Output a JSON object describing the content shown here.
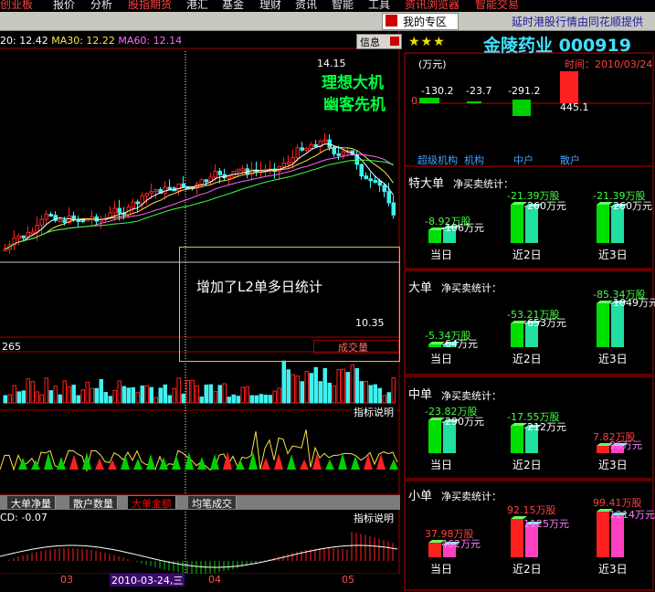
{
  "menu": {
    "items": [
      "创业板",
      "报价",
      "分析",
      "股指期货",
      "港汇",
      "基金",
      "理财",
      "资讯",
      "智能",
      "工具",
      "资讯浏览器",
      "智能交易"
    ]
  },
  "toolbar": {
    "my_zone": "我的专区",
    "provider": "延时港股行情由同花顺提供"
  },
  "chart": {
    "ma_prefix": "20: 12.42",
    "ma30": "MA30: 12.22",
    "ma60": "MA60: 12.14",
    "info_button": "信息",
    "high_price": "14.15",
    "low_price": "10.35",
    "watermark_line1": "理想大机",
    "watermark_line2": "幽客先机",
    "note": "增加了L2单多日统计",
    "volume_left": "265",
    "volume_label": "成交量",
    "indicator_explain": "指标说明",
    "macd": "CD: -0.07",
    "dates": [
      "03",
      "04",
      "05"
    ],
    "highlight_date": "2010-03-24,三"
  },
  "tabs": [
    "大单净量",
    "散户数量",
    "大单金额",
    "均笔成交"
  ],
  "tabs_active": 2,
  "right": {
    "stars": "★★★",
    "title": "金陵药业 000919",
    "unit": "(万元)",
    "time": "时间：2010/03/24",
    "flow_values": [
      "-130.2",
      "-23.7",
      "-291.2",
      "445.1"
    ],
    "zero": "0",
    "flow_categories": [
      "超级机构",
      "机构",
      "中户",
      "散户"
    ],
    "sections": [
      {
        "title": "特大单",
        "subtitle": "净买卖统计：",
        "items": [
          {
            "day": "当日",
            "shares": "-8.92万股",
            "amount": "-106万元"
          },
          {
            "day": "近2日",
            "shares": "-21.39万股",
            "amount": "-260万元"
          },
          {
            "day": "近3日",
            "shares": "-21.39万股",
            "amount": "-260万元"
          }
        ]
      },
      {
        "title": "大单",
        "subtitle": "净买卖统计：",
        "items": [
          {
            "day": "当日",
            "shares": "-5.34万股",
            "amount": "-64万元"
          },
          {
            "day": "近2日",
            "shares": "-53.21万股",
            "amount": "-653万元"
          },
          {
            "day": "近3日",
            "shares": "-85.34万股",
            "amount": "-1049万元"
          }
        ]
      },
      {
        "title": "中单",
        "subtitle": "净买卖统计：",
        "items": [
          {
            "day": "当日",
            "shares": "-23.82万股",
            "amount": "-290万元"
          },
          {
            "day": "近2日",
            "shares": "-17.55万股",
            "amount": "-212万元"
          },
          {
            "day": "近3日",
            "shares": "7.82万股",
            "amount": "96万元"
          }
        ]
      },
      {
        "title": "小单",
        "subtitle": "净买卖统计：",
        "items": [
          {
            "day": "当日",
            "shares": "37.98万股",
            "amount": "462万元"
          },
          {
            "day": "近2日",
            "shares": "92.15万股",
            "amount": "1125万元"
          },
          {
            "day": "近3日",
            "shares": "99.41万股",
            "amount": "1214万元"
          }
        ]
      }
    ]
  },
  "colors": {
    "up": "#ff2020",
    "down": "#40f0f0",
    "buy_green": "#00d000",
    "frame": "#a00000"
  }
}
